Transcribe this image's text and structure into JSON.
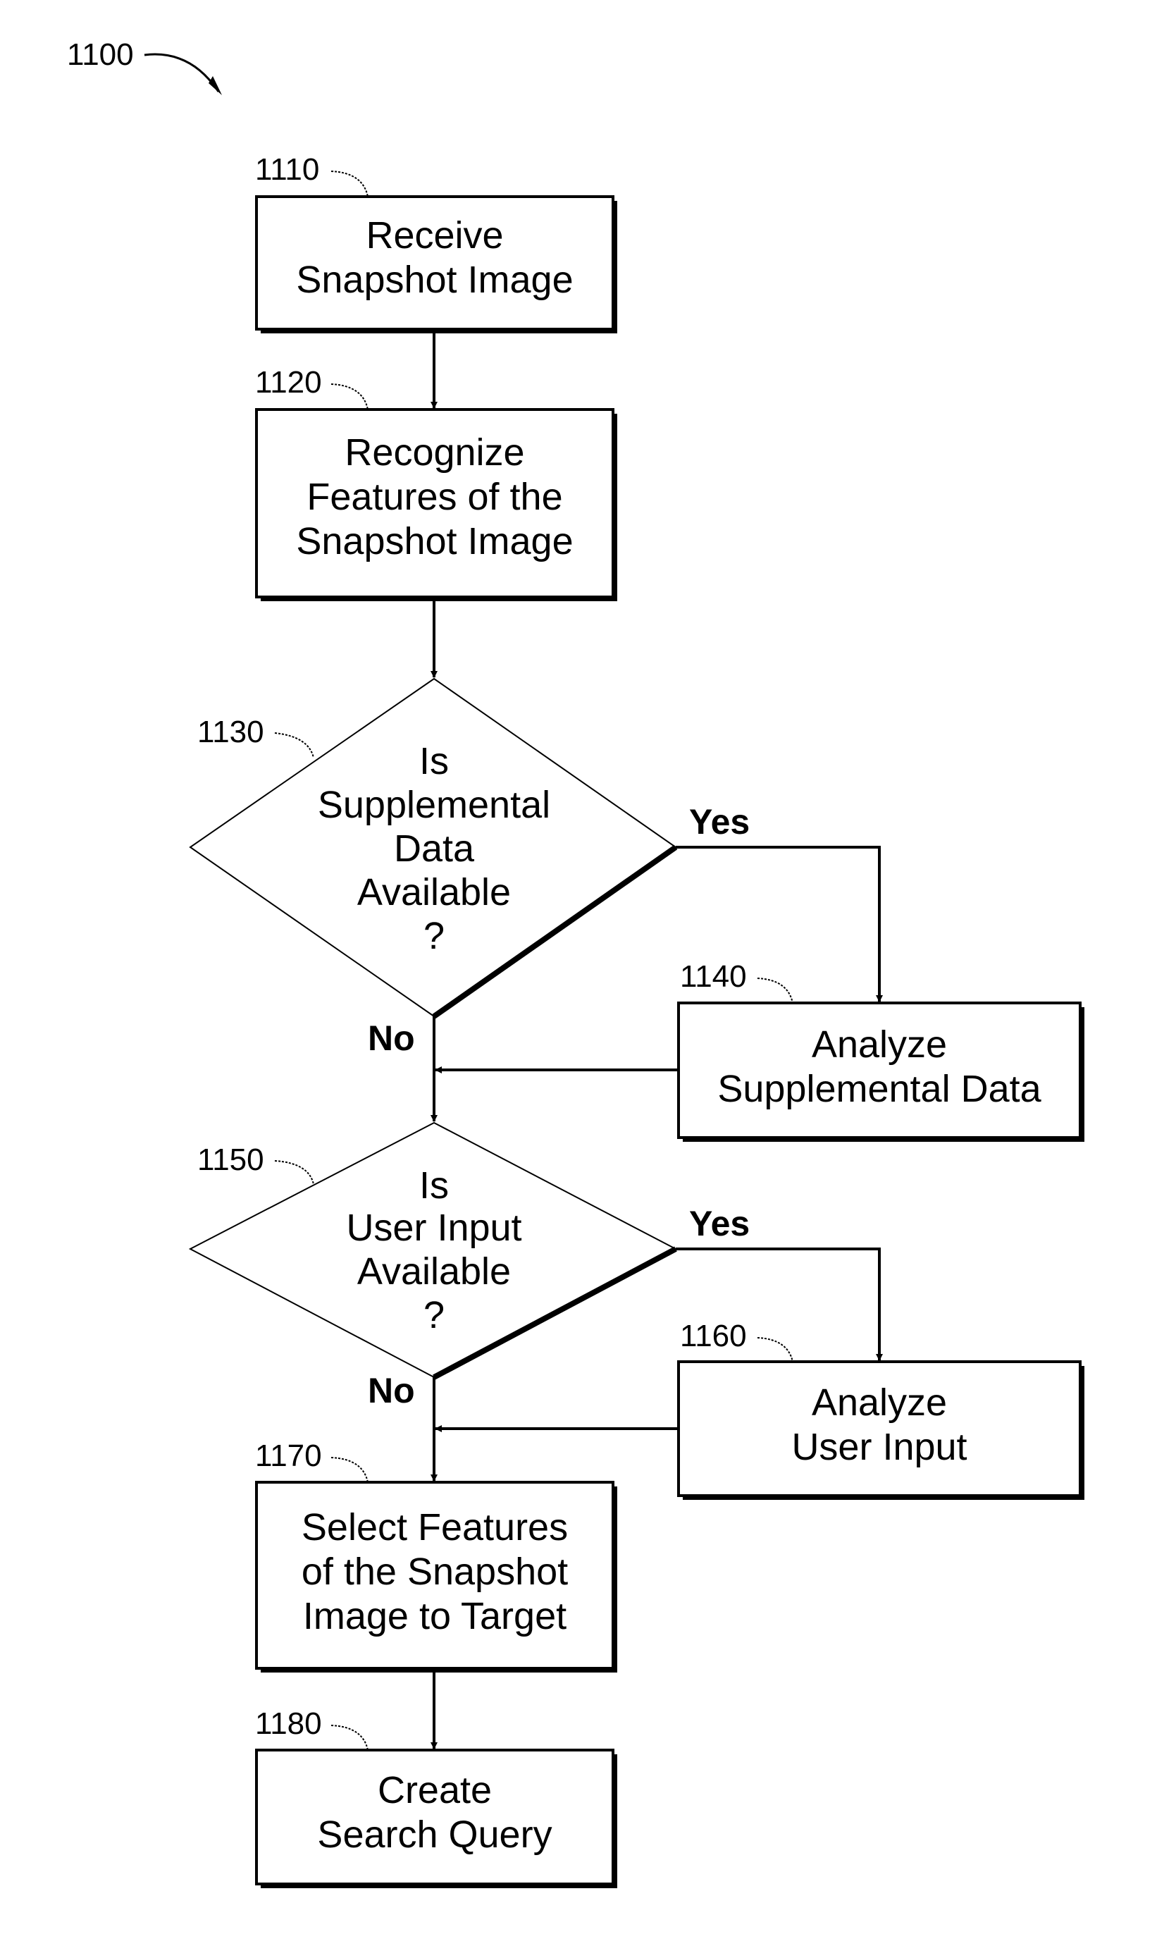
{
  "figure": {
    "ref": "1100",
    "nodes": [
      {
        "ref": "1110",
        "type": "process",
        "lines": [
          "Receive",
          "Snapshot Image"
        ]
      },
      {
        "ref": "1120",
        "type": "process",
        "lines": [
          "Recognize",
          "Features of the",
          "Snapshot Image"
        ]
      },
      {
        "ref": "1130",
        "type": "decision",
        "lines": [
          "Is",
          "Supplemental",
          "Data",
          "Available",
          "?"
        ]
      },
      {
        "ref": "1140",
        "type": "process",
        "lines": [
          "Analyze",
          "Supplemental Data"
        ]
      },
      {
        "ref": "1150",
        "type": "decision",
        "lines": [
          "Is",
          "User Input",
          "Available",
          "?"
        ]
      },
      {
        "ref": "1160",
        "type": "process",
        "lines": [
          "Analyze",
          "User Input"
        ]
      },
      {
        "ref": "1170",
        "type": "process",
        "lines": [
          "Select Features",
          "of the Snapshot",
          "Image to Target"
        ]
      },
      {
        "ref": "1180",
        "type": "process",
        "lines": [
          "Create",
          "Search Query"
        ]
      }
    ],
    "edge_labels": {
      "yes": "Yes",
      "no": "No"
    }
  }
}
